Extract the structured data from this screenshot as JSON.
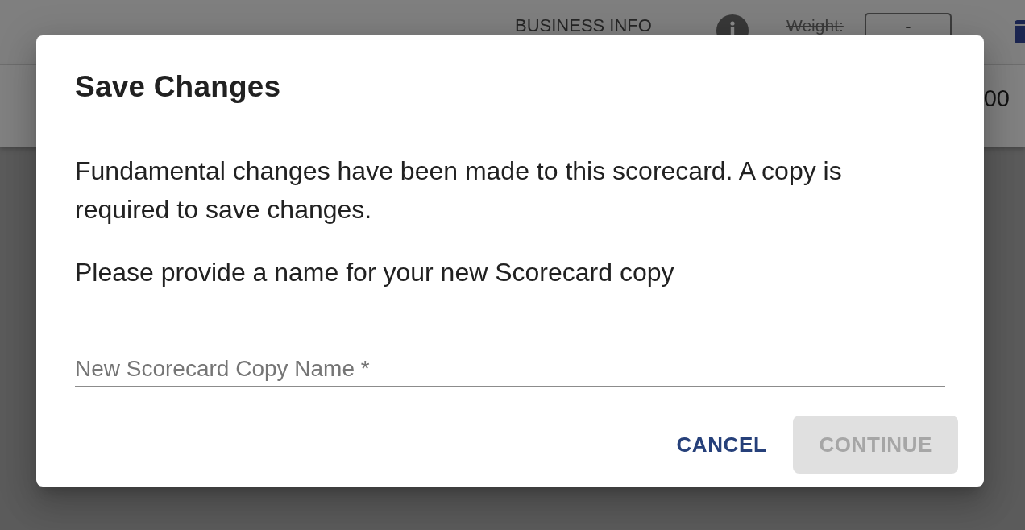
{
  "background_page": {
    "header": {
      "section_title": "BUSINESS INFO",
      "weight_label": {
        "text": "Weight:",
        "struck": true
      },
      "weight_field": {
        "value": "-"
      }
    },
    "row": {
      "value_text": "00"
    }
  },
  "dialog": {
    "title": "Save Changes",
    "paragraphs": [
      "Fundamental changes have been made to this scorecard. A copy is required to save changes.",
      "Please provide a name for your new Scorecard copy"
    ],
    "name_field": {
      "placeholder": "New Scorecard Copy Name *"
    },
    "buttons": [
      {
        "label": "CANCEL",
        "kind": "text",
        "disabled": false
      },
      {
        "label": "CONTINUE",
        "kind": "contained",
        "disabled": true
      }
    ]
  }
}
